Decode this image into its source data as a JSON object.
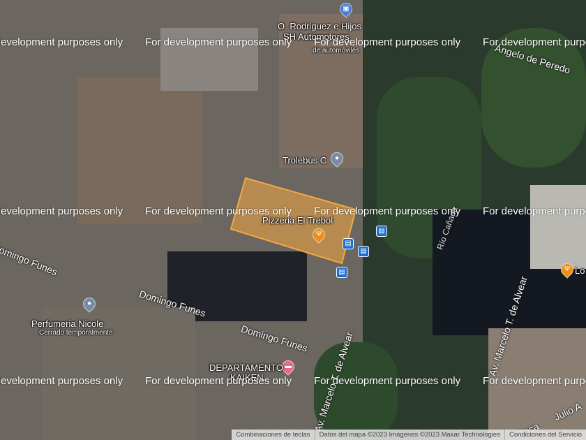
{
  "map": {
    "watermark": "For development purposes only",
    "places": {
      "rodriguez_line1": "O. Rodriguez e Hijos",
      "rodriguez_line2": "SH Automotores",
      "rodriguez_category": "de automóviles",
      "trolebus": "Trolebús C",
      "pizzeria": "Pizzeria El Trebol",
      "perfumeria": "Perfumeria Nicole",
      "perfumeria_status": "Cerrado temporalmente",
      "departamento_line1": "DEPARTAMENTO",
      "departamento_line2": "KAIKEN",
      "lo": "Lo"
    },
    "streets": {
      "peredo": "Ángelo de Peredo",
      "funes": "Domingo Funes",
      "alvear": "Av. Marcelo T. de Alvear",
      "canada": "Río Cañada",
      "julio": "Julio A",
      "roca": "Roca"
    },
    "highlight_color": "#f5a742"
  },
  "footer": {
    "shortcuts": "Combinaciones de teclas",
    "attribution": "Datos del mapa ©2023 Imágenes ©2023 Maxar Technologies",
    "terms": "Condiciones del Servicio"
  }
}
